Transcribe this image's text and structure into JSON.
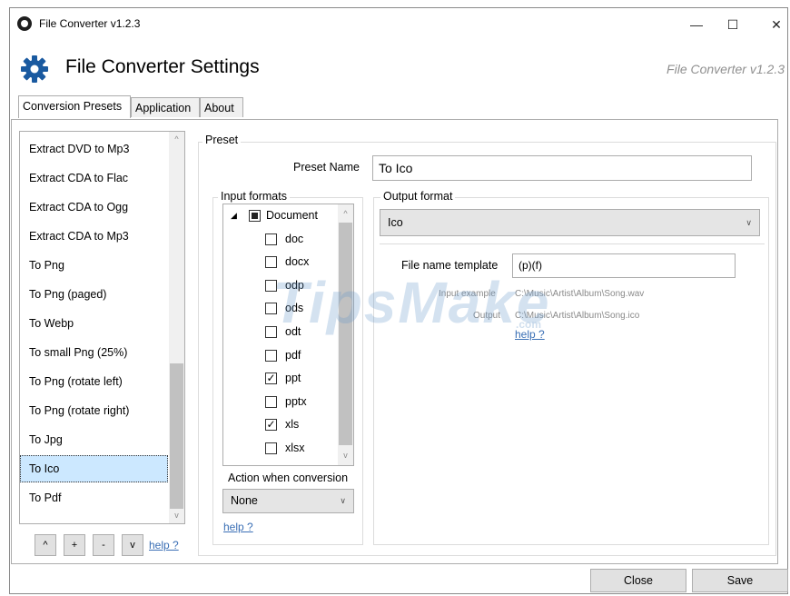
{
  "window": {
    "title": "File Converter v1.2.3",
    "controls": {
      "minimize": "—",
      "maximize": "☐",
      "close": "✕"
    }
  },
  "header": {
    "title": "File Converter Settings",
    "version": "File Converter v1.2.3",
    "icon": "gear-icon",
    "icon_color": "#1a5aa0"
  },
  "tabs": [
    "Conversion Presets",
    "Application",
    "About"
  ],
  "presets": {
    "items": [
      "Extract DVD to Mp3",
      "Extract CDA to Flac",
      "Extract CDA to Ogg",
      "Extract CDA to Mp3",
      "To Png",
      "To Png (paged)",
      "To Webp",
      "To small Png (25%)",
      "To Png (rotate left)",
      "To Png (rotate right)",
      "To Jpg",
      "To Ico",
      "To Pdf"
    ],
    "selected": "To Ico",
    "buttons": {
      "up": "^",
      "add": "+",
      "remove": "-",
      "down": "v"
    },
    "help": "help ?"
  },
  "preset": {
    "group_label": "Preset",
    "name_label": "Preset Name",
    "name_value": "To Ico",
    "input_formats": {
      "label": "Input formats",
      "category": "Document",
      "items": [
        {
          "name": "doc",
          "checked": false
        },
        {
          "name": "docx",
          "checked": false
        },
        {
          "name": "odp",
          "checked": false
        },
        {
          "name": "ods",
          "checked": false
        },
        {
          "name": "odt",
          "checked": false
        },
        {
          "name": "pdf",
          "checked": false
        },
        {
          "name": "ppt",
          "checked": true
        },
        {
          "name": "pptx",
          "checked": false
        },
        {
          "name": "xls",
          "checked": true
        },
        {
          "name": "xlsx",
          "checked": false
        }
      ]
    },
    "action_label": "Action when conversion",
    "action_value": "None",
    "help": "help ?"
  },
  "output": {
    "group_label": "Output format",
    "format_value": "Ico",
    "template_label": "File name template",
    "template_value": "(p)(f)",
    "input_example_label": "Input example",
    "input_example_value": "C:\\Music\\Artist\\Album\\Song.wav",
    "output_label": "Output",
    "output_value": "C:\\Music\\Artist\\Album\\Song.ico",
    "help": "help ?"
  },
  "watermark": {
    "text": "TipsMake",
    "sub": ".com"
  },
  "footer": {
    "close": "Close",
    "save": "Save"
  }
}
